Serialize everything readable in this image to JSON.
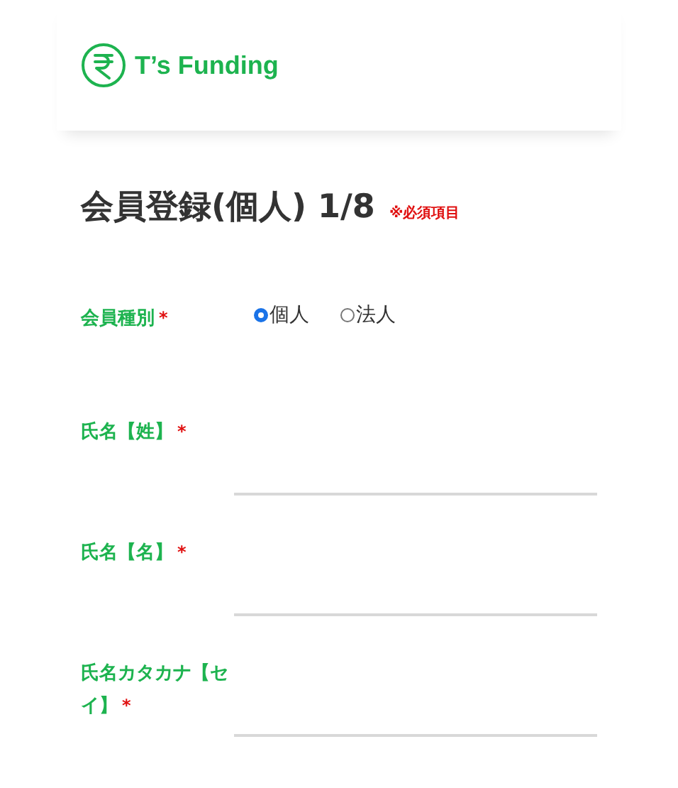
{
  "header": {
    "brand": "T’s Funding"
  },
  "title": {
    "text": "会員登録(個人) 1/8",
    "note": "※必須項目"
  },
  "fields": [
    {
      "kind": "radio",
      "label": "会員種別",
      "mark": "*",
      "options": [
        {
          "label": "個人",
          "selected": true
        },
        {
          "label": "法人",
          "selected": false
        }
      ]
    },
    {
      "kind": "text",
      "label": "氏名【姓】",
      "mark": "*"
    },
    {
      "kind": "text",
      "label": "氏名【名】",
      "mark": "*"
    },
    {
      "kind": "text",
      "label": "氏名カタカナ【セイ】",
      "mark": "*"
    }
  ]
}
